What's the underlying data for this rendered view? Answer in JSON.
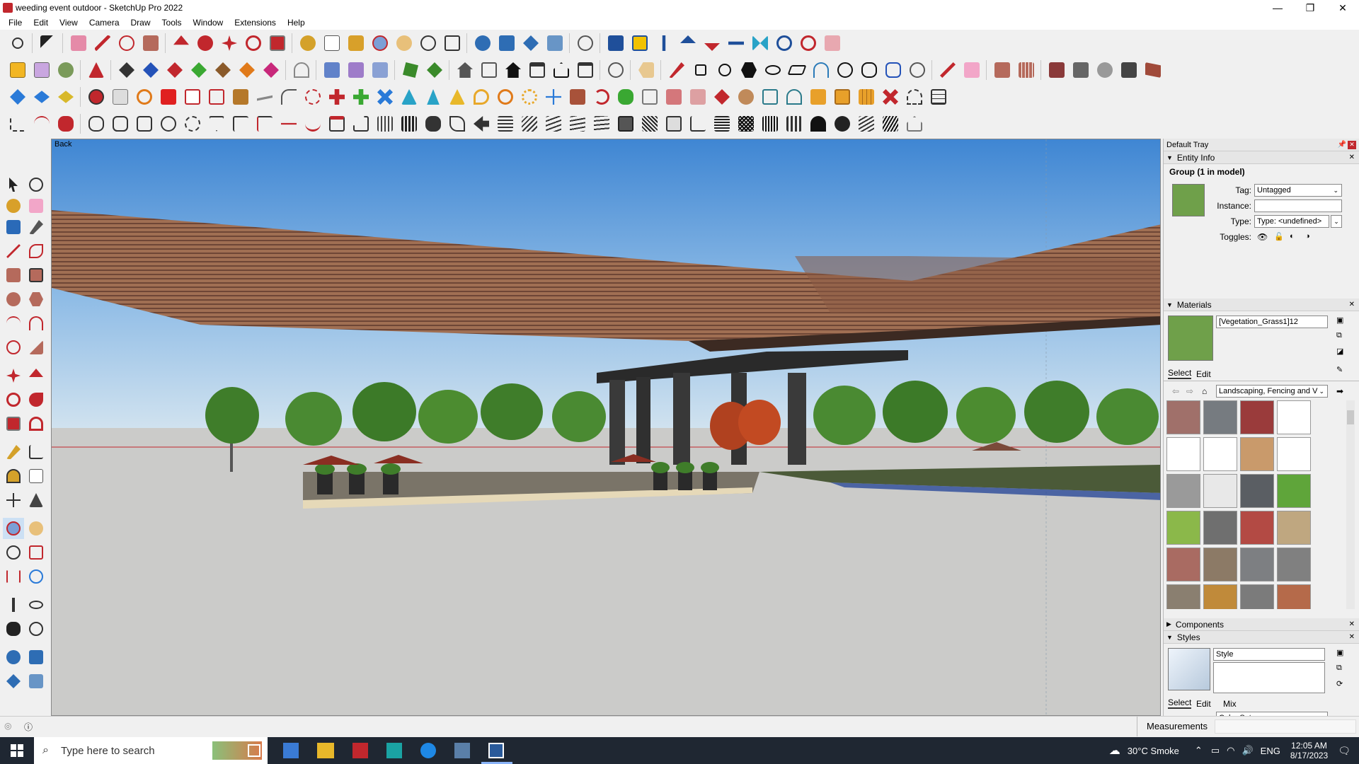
{
  "window": {
    "title": "weeding event outdoor - SketchUp Pro 2022",
    "controls": [
      "—",
      "❐",
      "✕"
    ]
  },
  "menu": [
    "File",
    "Edit",
    "View",
    "Camera",
    "Draw",
    "Tools",
    "Window",
    "Extensions",
    "Help"
  ],
  "viewport": {
    "scene_label": "Back"
  },
  "tray": {
    "title": "Default Tray",
    "entity_info": {
      "header": "Entity Info",
      "selection": "Group (1 in model)",
      "tag_label": "Tag:",
      "tag_value": "Untagged",
      "instance_label": "Instance:",
      "instance_value": "",
      "type_label": "Type:",
      "type_value": "Type: <undefined>",
      "toggles_label": "Toggles:"
    },
    "materials": {
      "header": "Materials",
      "material_name": "[Vegetation_Grass1]12",
      "tab_select": "Select",
      "tab_edit": "Edit",
      "library": "Landscaping, Fencing and V",
      "swatch_colors": [
        "#a0706a",
        "#767b80",
        "#9a3b3b",
        "#ffffff",
        "#ffffff",
        "#ffffff",
        "#c99a6b",
        "#ffffff",
        "#9a9a9a",
        "#e8e8e8",
        "#5a5e63",
        "#5fa53a",
        "#8bb84a",
        "#6f6f6f",
        "#b34a44",
        "#bfa780",
        "#a96b62",
        "#8c7a66",
        "#7d7f82",
        "#808080",
        "#8a7f70",
        "#c08a3a",
        "#7b7b7b",
        "#b56a4a"
      ]
    },
    "components": {
      "header": "Components"
    },
    "styles": {
      "header": "Styles",
      "style_name": "Style",
      "tab_select": "Select",
      "tab_edit": "Edit",
      "tab_mix": "Mix",
      "library": "Color Sets"
    }
  },
  "statusbar": {
    "measurements_label": "Measurements"
  },
  "taskbar": {
    "search_placeholder": "Type here to search",
    "weather": "30°C  Smoke",
    "language": "ENG",
    "time": "12:05 AM",
    "date": "8/17/2023"
  },
  "colors": {
    "sky_top": "#4a8fd6",
    "sky_bottom": "#c6dcee",
    "ground": "#cbcbc9",
    "canopy": "#9a6c52",
    "foliage": "#3f7d2a",
    "accent_red": "#c1272d"
  }
}
